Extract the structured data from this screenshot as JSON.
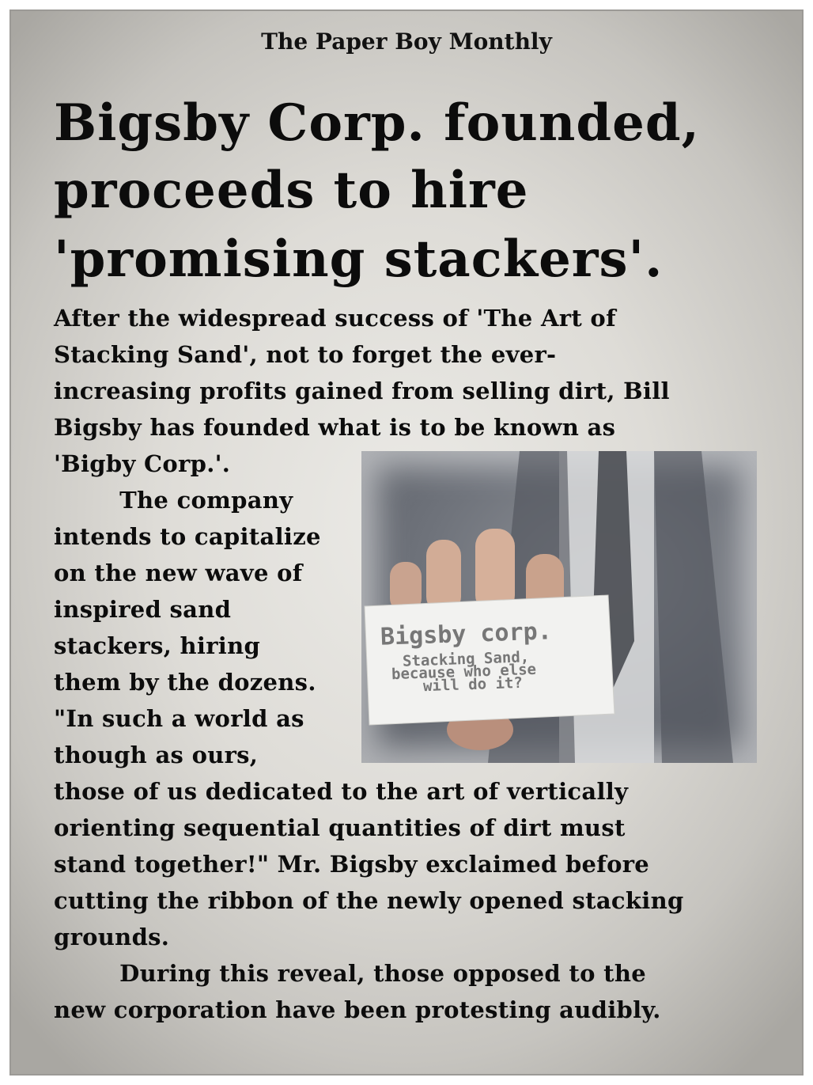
{
  "publication": "The Paper Boy Monthly",
  "headline": [
    "Bigsby Corp. founded,",
    "proceeds to hire",
    "'promising stackers'."
  ],
  "body_lines": [
    "After the widespread success of 'The Art of",
    "Stacking Sand', not to forget the ever-",
    "increasing profits gained from selling dirt, Bill",
    "Bigsby has founded what is to be known as",
    "'Bigby Corp.'.",
    "        The company",
    "intends to capitalize",
    "on the new wave of",
    "inspired sand",
    "stackers, hiring",
    "them by the dozens.",
    "\"In such a world as",
    "though as ours,",
    "those of us dedicated to the art of vertically",
    "orienting sequential quantities of dirt must",
    "stand together!\" Mr. Bigsby exclaimed before",
    "cutting the ribbon of the newly opened stacking",
    "grounds.",
    "        During this reveal, those opposed to the",
    "new corporation have been protesting audibly."
  ],
  "photo": {
    "card_title": "Bigsby corp.",
    "card_tagline_1": "Stacking Sand,",
    "card_tagline_2": "because who else",
    "card_tagline_3": "will do it?"
  }
}
